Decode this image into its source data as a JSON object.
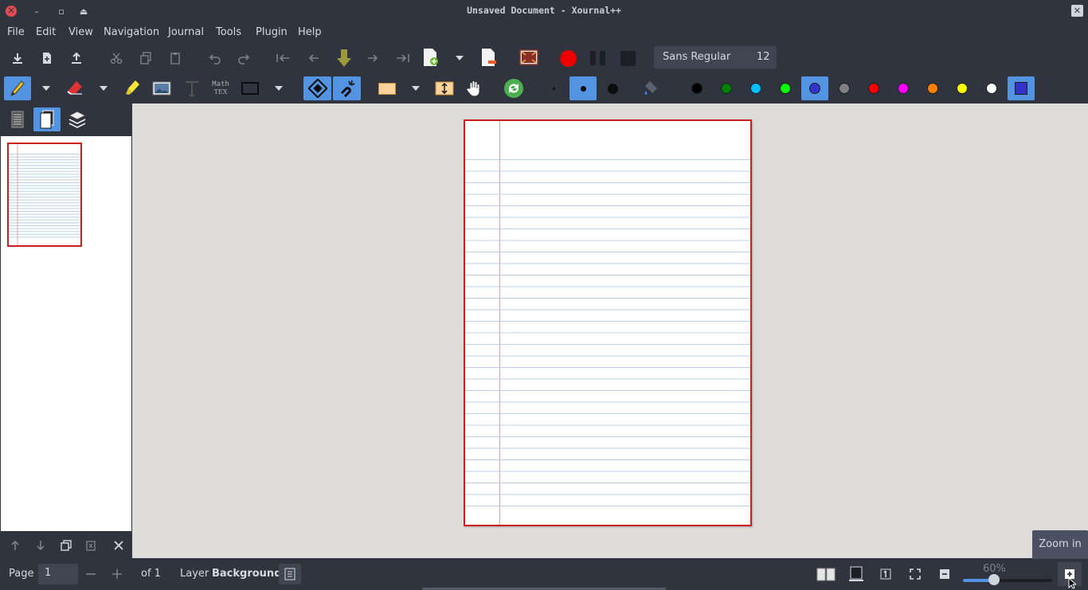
{
  "window": {
    "title": "Unsaved Document - Xournal++"
  },
  "menu": {
    "items": [
      "File",
      "Edit",
      "View",
      "Navigation",
      "Journal",
      "Tools",
      "Plugin",
      "Help"
    ]
  },
  "font_selector": {
    "name": "Sans Regular",
    "size": "12"
  },
  "toolbar2": {
    "latex_label_top": "Math",
    "latex_label_bottom": "TEX"
  },
  "colors": [
    "#000000",
    "#008000",
    "#00c0ff",
    "#00ff00",
    "#3333cc",
    "#808080",
    "#ff0000",
    "#ff00ff",
    "#ff8000",
    "#ffff00",
    "#ffffff"
  ],
  "selected_color": "#3333cc",
  "status": {
    "page_label": "Page",
    "page_value": "1",
    "page_of": "of 1",
    "layer_label": "Layer",
    "layer_value": "Background",
    "zoom": "60%",
    "zoom_fraction": 0.35
  },
  "tooltip": {
    "text": "Zoom in"
  },
  "accent": "#5294e2"
}
